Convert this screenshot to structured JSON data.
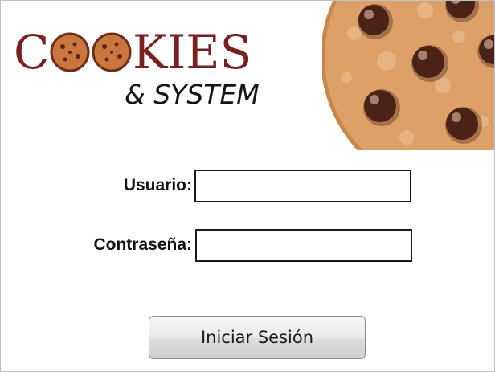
{
  "logo": {
    "word_pre": "C",
    "word_post": "KIES",
    "subtitle": "& SYSTEM"
  },
  "form": {
    "username_label": "Usuario:",
    "username_value": "",
    "password_label": "Contraseña:",
    "password_value": ""
  },
  "actions": {
    "login_label": "Iniciar Sesión"
  },
  "colors": {
    "logo_red": "#7b1f1f",
    "cookie_dough": "#d99a5b",
    "chocolate_chip": "#4a2316"
  }
}
